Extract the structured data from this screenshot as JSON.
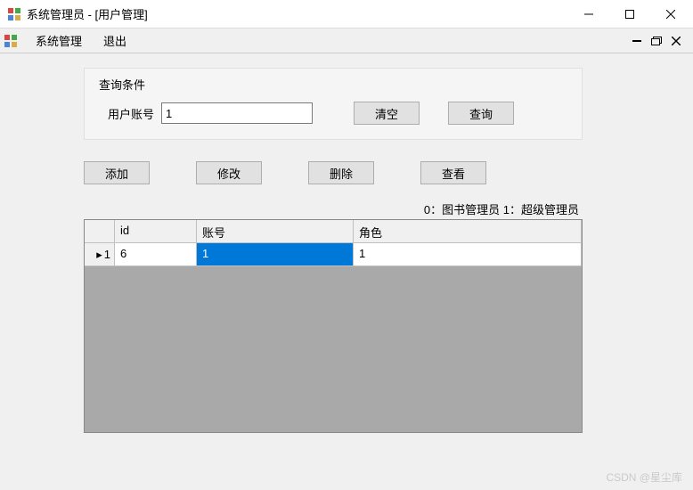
{
  "window": {
    "title": "系统管理员 - [用户管理]"
  },
  "menubar": {
    "items": [
      "系统管理",
      "退出"
    ]
  },
  "search": {
    "legend": "查询条件",
    "label": "用户账号",
    "value": "1",
    "clear_btn": "清空",
    "query_btn": "查询"
  },
  "actions": {
    "add": "添加",
    "edit": "修改",
    "delete": "删除",
    "view": "查看"
  },
  "role_legend": "0：图书管理员  1：超级管理员",
  "grid": {
    "columns": [
      "id",
      "账号",
      "角色"
    ],
    "rows": [
      {
        "rownum": "1",
        "id": "6",
        "account": "1",
        "role": "1",
        "selected_col": "account"
      }
    ]
  },
  "watermark": "CSDN @星尘库"
}
